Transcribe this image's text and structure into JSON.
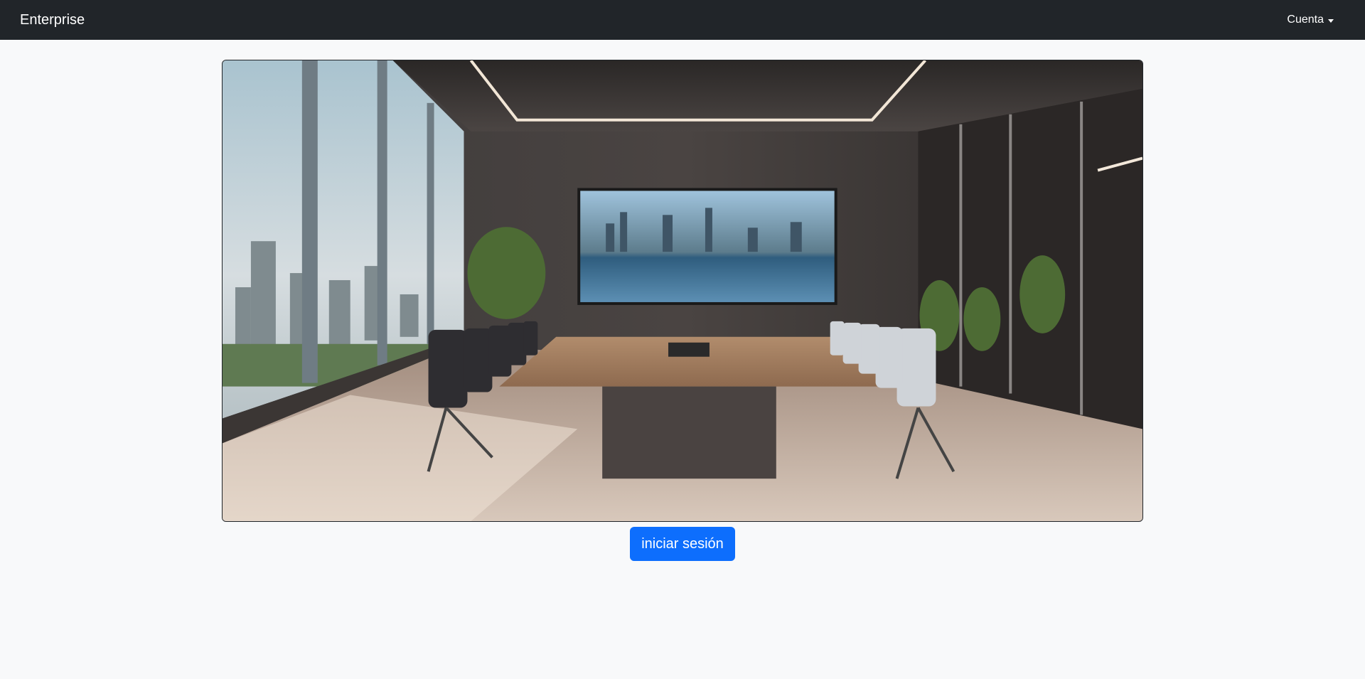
{
  "navbar": {
    "brand": "Enterprise",
    "account_menu_label": "Cuenta"
  },
  "hero": {
    "image_icon": "conference-room-photo"
  },
  "actions": {
    "login_label": "iniciar sesión"
  },
  "colors": {
    "navbar_bg": "#212529",
    "page_bg": "#f8f9fa",
    "primary": "#0d6efd"
  }
}
